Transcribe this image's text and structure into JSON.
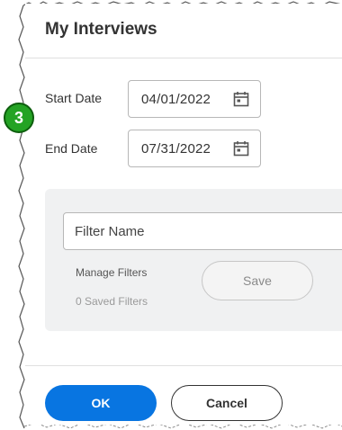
{
  "dialog": {
    "title": "My Interviews"
  },
  "dates": {
    "start_label": "Start Date",
    "start_value": "04/01/2022",
    "end_label": "End Date",
    "end_value": "07/31/2022"
  },
  "step_badge": "3",
  "filters": {
    "name_placeholder": "Filter Name",
    "manage_label": "Manage Filters",
    "saved_count": "0 Saved Filters",
    "save_label": "Save"
  },
  "footer": {
    "ok_label": "OK",
    "cancel_label": "Cancel"
  },
  "colors": {
    "primary": "#0875e1",
    "badge": "#24a324"
  },
  "icons": {
    "date_picker": "calendar-icon"
  }
}
